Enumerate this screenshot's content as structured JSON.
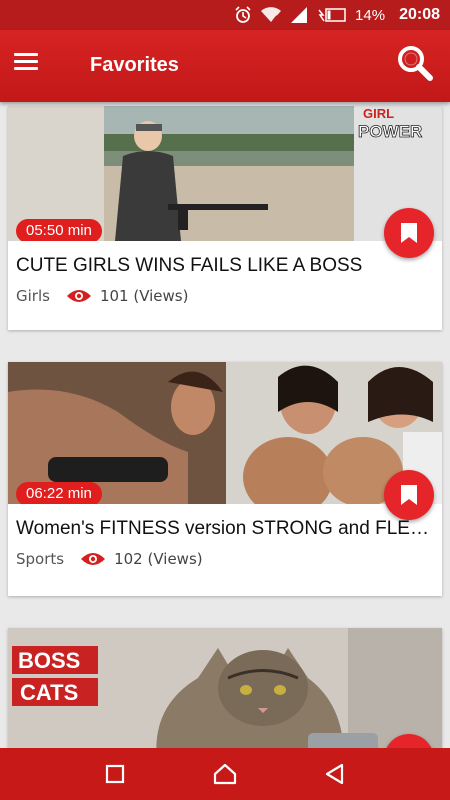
{
  "status_bar": {
    "battery": "14%",
    "time": "20:08"
  },
  "toolbar": {
    "title": "Favorites"
  },
  "videos": [
    {
      "duration": "05:50 min",
      "title": "CUTE GIRLS WINS FAILS  LIKE A BOSS",
      "category": "Girls",
      "views": "101 (Views)",
      "thumb_text": [
        "GIRL",
        "POWER"
      ]
    },
    {
      "duration": "06:22 min",
      "title": "Women's FITNESS version STRONG and FLEXI..",
      "category": "Sports",
      "views": "102 (Views)"
    },
    {
      "thumb_text": [
        "BOSS",
        "CATS"
      ]
    }
  ],
  "colors": {
    "primary": "#c81919",
    "accent": "#e5252a",
    "background": "#e9e9e9"
  },
  "icons": {
    "menu": "hamburger-icon",
    "search": "search-icon",
    "bookmark": "bookmark-icon",
    "views": "eye-icon",
    "nav_recent": "square-icon",
    "nav_home": "home-icon",
    "nav_back": "back-triangle-icon"
  }
}
